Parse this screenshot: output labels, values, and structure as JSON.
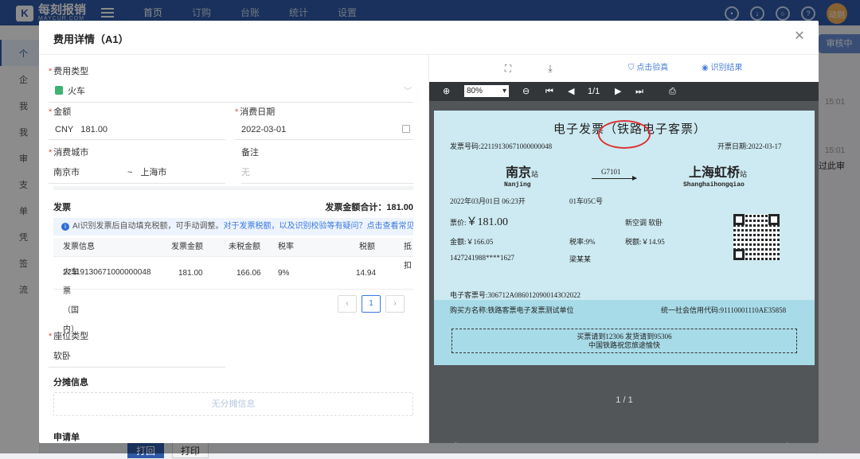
{
  "app": {
    "logo": "每刻报销",
    "logo_sub": "MAYCUR.COM"
  },
  "nav": [
    "首页",
    "订购",
    "台账",
    "统计",
    "设置"
  ],
  "user": {
    "avatar": "动则"
  },
  "sidebar": [
    "个",
    "企",
    "我",
    "我",
    "审",
    "支",
    "单",
    "凭",
    "签",
    "流"
  ],
  "background": {
    "review_button": "审核中",
    "time1": "15:01",
    "time2": "15:01",
    "snippet": "过此审"
  },
  "bottom_buttons": [
    "打回",
    "打印"
  ],
  "modal": {
    "title": "费用详情（A1）",
    "expense_type_label": "费用类型",
    "expense_type": "火车",
    "amount_label": "金额",
    "currency": "CNY",
    "amount": "181.00",
    "date_label": "消费日期",
    "date": "2022-03-01",
    "city_label": "消费城市",
    "city_from": "南京市",
    "city_sep": "~",
    "city_to": "上海市",
    "remark_label": "备注",
    "remark_placeholder": "无",
    "invoice_section": "发票",
    "invoice_total": "发票金额合计：181.00",
    "tip": "AI识别发票后自动填充税额，可手动调整。",
    "tip_link": "对于发票税额，以及识别校验等有疑问？点击查看常见问题",
    "table_headers": [
      "发票信息",
      "发票金额",
      "未税金额",
      "税率",
      "税额",
      "抵扣"
    ],
    "table_row": {
      "name": "火车票（国内）",
      "number": "22119130671000000048",
      "amount": "181.00",
      "untaxed": "166.06",
      "rate": "9%",
      "tax": "14.94"
    },
    "page": "1",
    "seat_label": "座位类型",
    "seat_value": "软卧",
    "split_section": "分摊信息",
    "split_empty": "无分摊信息",
    "request_section": "申请单"
  },
  "viewer": {
    "verify": "点击验真",
    "result": "识别结果",
    "zoom": "80%",
    "page_indicator": "1/1",
    "page_count": "1 / 1"
  },
  "ticket": {
    "title": "电子发票（铁路电子客票）",
    "invoice_no": "发票号码:22119130671000000048",
    "issue_date": "开票日期:2022-03-17",
    "from_station": "南京",
    "from_suffix": "站",
    "from_pinyin": "Nanjing",
    "to_station": "上海虹桥",
    "to_suffix": "站",
    "to_pinyin": "Shanghaihongqiao",
    "train_no": "G7101",
    "depart": "2022年03月01日   06:23开",
    "car_seat": "01车05C号",
    "fare_label": "票价:",
    "fare": "￥181.00",
    "seat_class": "新空调 软卧",
    "amount": "金额:￥166.05",
    "tax_rate": "税率:9%",
    "tax": "税额:￥14.95",
    "id_no": "1427241988****1627",
    "passenger": "梁某某",
    "eticket_no": "电子客票号:306712A0860120900143O2022",
    "buyer": "购买方名称:铁路客票电子发票测试单位",
    "credit_code": "统一社会信用代码:91110001110AE35858",
    "notice1": "买票请到12306 发货请到95306",
    "notice2": "中国铁路祝您旅途愉快"
  }
}
